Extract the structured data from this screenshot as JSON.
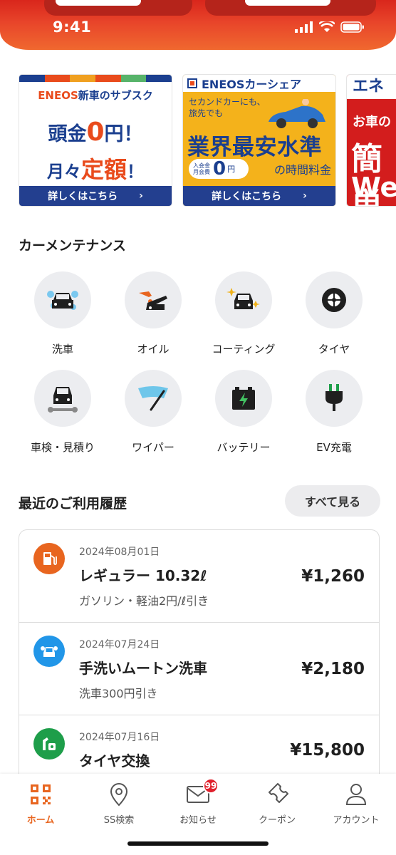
{
  "status_bar": {
    "time": "9:41",
    "icons": [
      "signal-icon",
      "wifi-icon",
      "battery-icon"
    ]
  },
  "banners": [
    {
      "brand": "ENEOS",
      "title_rest": "新車のサブスク",
      "line1_a": "頭金",
      "line1_zero": "0",
      "line1_b": "円！",
      "line2_a": "月々",
      "line2_b": "定額",
      "line2_c": "！",
      "cta": "詳しくはこちら",
      "stripe_colors": [
        "#1b3f8f",
        "#e94b1c",
        "#f0a020",
        "#e94b1c",
        "#57b36a",
        "#1b3f8f"
      ]
    },
    {
      "brand": "ENEOSカーシェア",
      "sub1": "セカンドカーにも、",
      "sub2": "旅先でも",
      "big": "業界最安水準",
      "fee_l1": "入会金",
      "fee_l2": "月会費",
      "zero": "0",
      "yen": "円",
      "jikan": "の時間料金",
      "cta": "詳しくはこちら"
    },
    {
      "brand": "エネ",
      "l1": "お車の",
      "l2": "簡単",
      "l3": "We"
    }
  ],
  "maintenance": {
    "title": "カーメンテナンス",
    "items": [
      {
        "label": "洗車",
        "icon": "car-wash-icon"
      },
      {
        "label": "オイル",
        "icon": "oil-icon"
      },
      {
        "label": "コーティング",
        "icon": "coating-icon"
      },
      {
        "label": "タイヤ",
        "icon": "tire-icon"
      },
      {
        "label": "車検・見積り",
        "icon": "inspection-icon"
      },
      {
        "label": "ワイパー",
        "icon": "wiper-icon"
      },
      {
        "label": "バッテリー",
        "icon": "battery-icon"
      },
      {
        "label": "EV充電",
        "icon": "ev-plug-icon"
      }
    ]
  },
  "history": {
    "title": "最近のご利用履歴",
    "see_all": "すべて見る",
    "items": [
      {
        "date": "2024年08月01日",
        "title": "レギュラー 10.32ℓ",
        "note": "ガソリン・軽油2円/ℓ引き",
        "price": "¥1,260",
        "icon": "fuel-icon",
        "color": "#e8651f"
      },
      {
        "date": "2024年07月24日",
        "title": "手洗いムートン洗車",
        "note": "洗車300円引き",
        "price": "¥2,180",
        "icon": "car-wash-icon",
        "color": "#2196e8"
      },
      {
        "date": "2024年07月16日",
        "title": "タイヤ交換",
        "note": "",
        "price": "¥15,800",
        "icon": "tire-service-icon",
        "color": "#1e9e4a"
      }
    ]
  },
  "bottom_nav": {
    "items": [
      {
        "label": "ホーム",
        "icon": "qr-code-icon",
        "active": true
      },
      {
        "label": "SS検索",
        "icon": "location-pin-icon"
      },
      {
        "label": "お知らせ",
        "icon": "mail-icon",
        "badge": "99"
      },
      {
        "label": "クーポン",
        "icon": "coupon-icon"
      },
      {
        "label": "アカウント",
        "icon": "person-icon"
      }
    ]
  },
  "colors": {
    "brand_orange": "#e8651f",
    "header_red": "#d9261c",
    "navy": "#1b3f8f"
  }
}
